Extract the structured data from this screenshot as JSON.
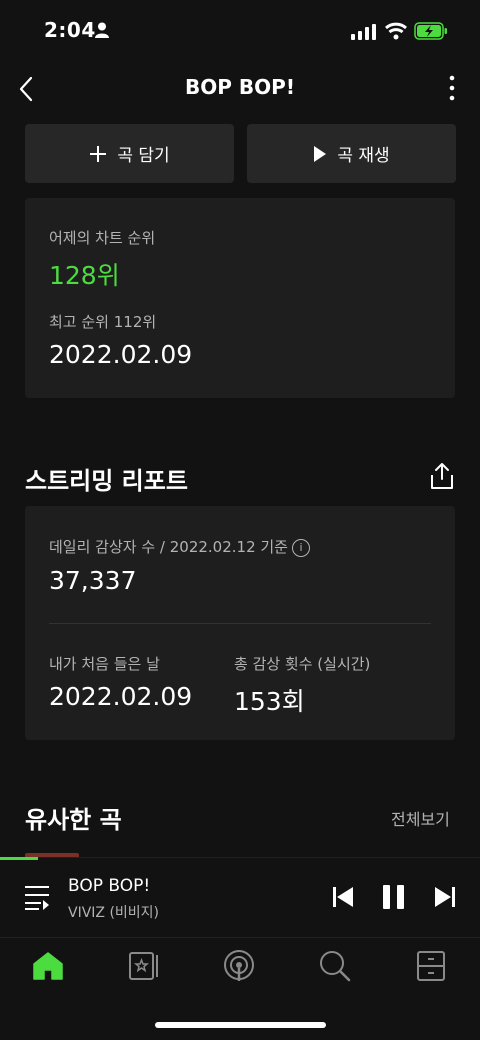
{
  "status_bar": {
    "time": "2:04"
  },
  "header": {
    "title": "BOP BOP!"
  },
  "actions": {
    "add_label": "곡 담기",
    "play_label": "곡 재생"
  },
  "chart_rank": {
    "yesterday_label": "어제의 차트 순위",
    "yesterday_rank": "128위",
    "peak_label": "최고 순위 112위",
    "peak_date": "2022.02.09"
  },
  "report": {
    "title": "스트리밍 리포트",
    "daily_label": "데일리 감상자 수 / 2022.02.12 기준",
    "daily_value": "37,337",
    "first_heard_label": "내가 처음 들은 날",
    "first_heard_value": "2022.02.09",
    "total_label": "총 감상 횟수 (실시간)",
    "total_value": "153회"
  },
  "similar": {
    "title": "유사한 곡",
    "see_all": "전체보기"
  },
  "player": {
    "title": "BOP BOP!",
    "artist": "VIVIZ (비비지)",
    "progress": 0.08
  },
  "colors": {
    "accent": "#4cdc3f",
    "background": "#121212",
    "card": "#1e1e1e"
  },
  "icons": [
    "person-icon",
    "signal-icon",
    "wifi-icon",
    "battery-charging-icon",
    "back-chevron-icon",
    "more-vertical-icon",
    "plus-icon",
    "play-icon",
    "share-icon",
    "info-icon",
    "queue-icon",
    "previous-icon",
    "pause-icon",
    "next-icon",
    "home-icon",
    "library-icon",
    "podcast-icon",
    "search-icon",
    "drawer-icon"
  ]
}
